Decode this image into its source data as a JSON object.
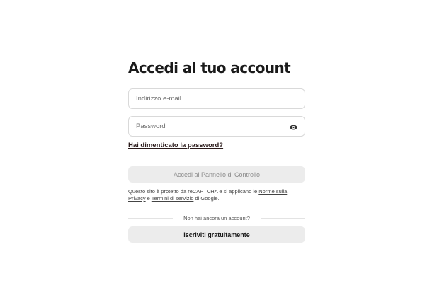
{
  "login": {
    "title": "Accedi al tuo account",
    "email": {
      "placeholder": "Indirizzo e-mail",
      "value": ""
    },
    "password": {
      "placeholder": "Password",
      "value": "",
      "toggle_icon": "eye-icon"
    },
    "forgot_link": "Hai dimenticato la password?",
    "submit_label": "Accedi al Pannello di Controllo",
    "recaptcha": {
      "text_before": "Questo sito è protetto da reCAPTCHA e si applicano le ",
      "privacy_link": "Norme sulla Privacy",
      "text_middle": " e ",
      "terms_link": "Termini di servizio",
      "text_after": " di Google."
    },
    "divider_text": "Non hai ancora un account?",
    "signup_label": "Iscriviti gratuitamente"
  },
  "colors": {
    "background": "#ffffff",
    "button_bg": "#ececec",
    "disabled_text": "#8c8c8c",
    "border": "#d9d9d9"
  }
}
